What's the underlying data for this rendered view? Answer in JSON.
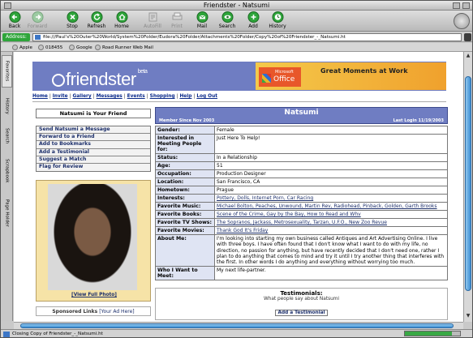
{
  "window": {
    "title": "Friendster - Natsumi"
  },
  "toolbar": {
    "buttons": [
      {
        "label": "Back",
        "enabled": true
      },
      {
        "label": "Forward",
        "enabled": false
      },
      {
        "label": "Stop",
        "enabled": true
      },
      {
        "label": "Refresh",
        "enabled": true
      },
      {
        "label": "Home",
        "enabled": true
      },
      {
        "label": "AutoFill",
        "enabled": false
      },
      {
        "label": "Print",
        "enabled": false
      },
      {
        "label": "Mail",
        "enabled": true
      },
      {
        "label": "Search",
        "enabled": true
      },
      {
        "label": "Add",
        "enabled": true
      },
      {
        "label": "History",
        "enabled": true
      }
    ]
  },
  "address": {
    "label": "Address:",
    "url": "file:///Paul's%20Outer%20World/System%20Folder/Eudora%20Folder/Attachments%20Folder/Copy%20of%20Friendster_-_Natsumi.ht"
  },
  "favorites": [
    "Apple",
    "018455",
    "Google",
    "Road Runner Web Mail"
  ],
  "sidetabs": [
    "Favorites",
    "History",
    "Search",
    "Scrapbook",
    "Page Holder"
  ],
  "friendster": {
    "logo": "friendster",
    "beta": "beta",
    "ad": {
      "brand_small": "Microsoft",
      "brand": "Office",
      "headline": "Great Moments at Work"
    },
    "nav": [
      "Home",
      "Invite",
      "Gallery",
      "Messages",
      "Events",
      "Shopping",
      "Help",
      "Log Out"
    ],
    "friend_box": "Natsumi is Your Friend",
    "actions": [
      "Send Natsumi a Message",
      "Forward to a Friend",
      "Add to Bookmarks",
      "Add a Testimonial",
      "Suggest a Match",
      "Flag for Review"
    ],
    "view_photo": "[View Full Photo]",
    "sponsored": "Sponsored Links",
    "ad_here": "[Your Ad Here]",
    "profile": {
      "name": "Natsumi",
      "member_since": "Member Since Nov 2003",
      "last_login": "Last Login 11/19/2003",
      "rows": [
        {
          "k": "Gender:",
          "v": "Female"
        },
        {
          "k": "Interested in Meeting People for:",
          "v": "Just Here To Help!"
        },
        {
          "k": "Status:",
          "v": "In a Relationship"
        },
        {
          "k": "Age:",
          "v": "51"
        },
        {
          "k": "Occupation:",
          "v": "Production Designer"
        },
        {
          "k": "Location:",
          "v": "San Francisco, CA"
        },
        {
          "k": "Hometown:",
          "v": "Prague"
        },
        {
          "k": "Interests:",
          "v": "Pottery, Dolls, Internet Porn, Car Racing"
        },
        {
          "k": "Favorite Music:",
          "v": "Michael Bolton, Peaches, Unwound, Martin Rev, Radiohead, Pinback, Golden, Garth Brooks"
        },
        {
          "k": "Favorite Books:",
          "v": "Scene of the Crime, Gay by the Bay, How to Read and Whv"
        },
        {
          "k": "Favorite TV Shows:",
          "v": "The Sopranos, Jackass, Metrosexuality, Tarzan, U.F.O., New Zoo Revue"
        },
        {
          "k": "Favorite Movies:",
          "v": "Thank God It's Friday"
        },
        {
          "k": "About Me:",
          "v": "I'm looking into starting my own business called Antiques and Art Advertising Online. I live with three boys. I have often found that I don't know what I want to do with my life, no direction, no passion for anything, but have recently decided that I don't need one, rather I plan to do anything that comes to mind and try it until I try another thing that interferes with the first. In other words I do anything and everything without worrying too much."
        },
        {
          "k": "Who I Want to Meet:",
          "v": "My next life-partner."
        }
      ]
    },
    "testimonials": {
      "title": "Testimonials:",
      "subtitle": "What people say about Natsumi",
      "add": "Add a Testimonial"
    }
  },
  "status": {
    "text": "Closing Copy of Friendster_-_Natsumi.ht",
    "progress": 0.85
  },
  "colors": {
    "accent": "#6f7dc2",
    "go_green": "#2ea53a"
  }
}
